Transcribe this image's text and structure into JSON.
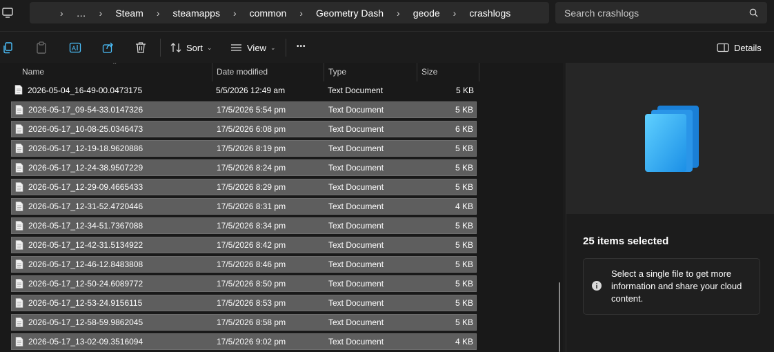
{
  "address": {
    "breadcrumbs": [
      "…",
      "Steam",
      "steamapps",
      "common",
      "Geometry Dash",
      "geode",
      "crashlogs"
    ],
    "search_placeholder": "Search crashlogs"
  },
  "toolbar": {
    "sort_label": "Sort",
    "view_label": "View",
    "details_label": "Details",
    "more_label": "•••"
  },
  "columns": {
    "name": "Name",
    "date": "Date modified",
    "type": "Type",
    "size": "Size"
  },
  "files": [
    {
      "name": "2026-05-04_16-49-00.0473175",
      "date": "5/5/2026 12:49 am",
      "type": "Text Document",
      "size": "5 KB",
      "selected": false
    },
    {
      "name": "2026-05-17_09-54-33.0147326",
      "date": "17/5/2026 5:54 pm",
      "type": "Text Document",
      "size": "5 KB",
      "selected": true
    },
    {
      "name": "2026-05-17_10-08-25.0346473",
      "date": "17/5/2026 6:08 pm",
      "type": "Text Document",
      "size": "6 KB",
      "selected": true
    },
    {
      "name": "2026-05-17_12-19-18.9620886",
      "date": "17/5/2026 8:19 pm",
      "type": "Text Document",
      "size": "5 KB",
      "selected": true
    },
    {
      "name": "2026-05-17_12-24-38.9507229",
      "date": "17/5/2026 8:24 pm",
      "type": "Text Document",
      "size": "5 KB",
      "selected": true
    },
    {
      "name": "2026-05-17_12-29-09.4665433",
      "date": "17/5/2026 8:29 pm",
      "type": "Text Document",
      "size": "5 KB",
      "selected": true
    },
    {
      "name": "2026-05-17_12-31-52.4720446",
      "date": "17/5/2026 8:31 pm",
      "type": "Text Document",
      "size": "4 KB",
      "selected": true
    },
    {
      "name": "2026-05-17_12-34-51.7367088",
      "date": "17/5/2026 8:34 pm",
      "type": "Text Document",
      "size": "5 KB",
      "selected": true
    },
    {
      "name": "2026-05-17_12-42-31.5134922",
      "date": "17/5/2026 8:42 pm",
      "type": "Text Document",
      "size": "5 KB",
      "selected": true
    },
    {
      "name": "2026-05-17_12-46-12.8483808",
      "date": "17/5/2026 8:46 pm",
      "type": "Text Document",
      "size": "5 KB",
      "selected": true
    },
    {
      "name": "2026-05-17_12-50-24.6089772",
      "date": "17/5/2026 8:50 pm",
      "type": "Text Document",
      "size": "5 KB",
      "selected": true
    },
    {
      "name": "2026-05-17_12-53-24.9156115",
      "date": "17/5/2026 8:53 pm",
      "type": "Text Document",
      "size": "5 KB",
      "selected": true
    },
    {
      "name": "2026-05-17_12-58-59.9862045",
      "date": "17/5/2026 8:58 pm",
      "type": "Text Document",
      "size": "5 KB",
      "selected": true
    },
    {
      "name": "2026-05-17_13-02-09.3516094",
      "date": "17/5/2026 9:02 pm",
      "type": "Text Document",
      "size": "4 KB",
      "selected": true
    }
  ],
  "details": {
    "selection_title": "25 items selected",
    "info_message": "Select a single file to get more information and share your cloud content."
  },
  "colors": {
    "background": "#1c1c1c",
    "selection": "#5e5e5e",
    "accent": "#4cc2ff"
  }
}
